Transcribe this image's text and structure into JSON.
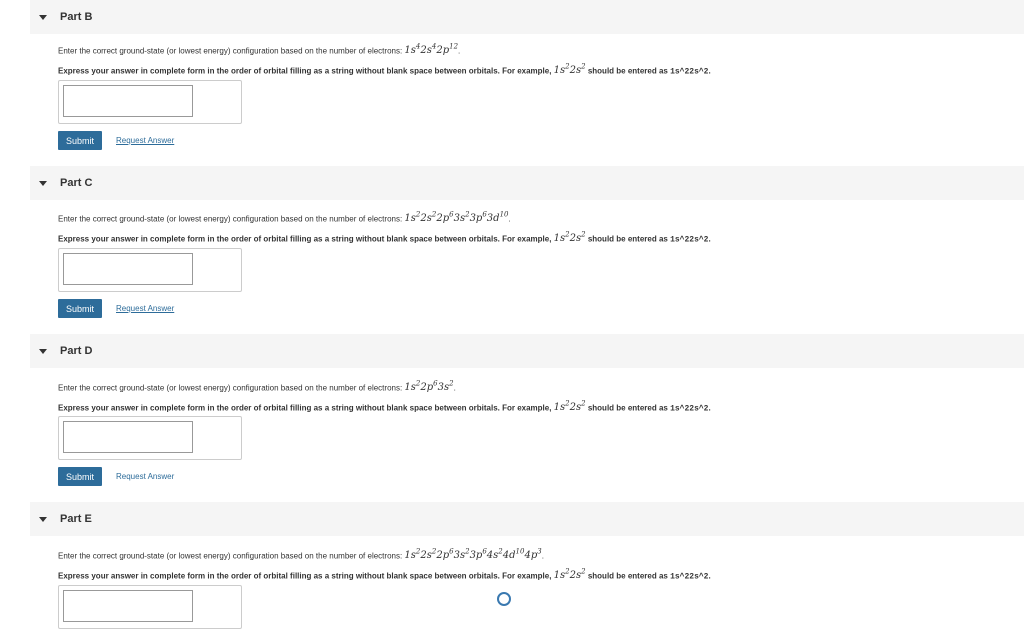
{
  "parts": [
    {
      "title": "Part B",
      "prompt": "Enter the correct ground-state (or lowest energy) configuration based on the number of electrons: ",
      "config": [
        [
          "1s",
          "4"
        ],
        [
          "2s",
          "4"
        ],
        [
          "2p",
          "12"
        ]
      ],
      "submit_label": "Submit",
      "request_label": "Request Answer"
    },
    {
      "title": "Part C",
      "prompt": "Enter the correct ground-state (or lowest energy) configuration based on the number of electrons: ",
      "config": [
        [
          "1s",
          "2"
        ],
        [
          "2s",
          "2"
        ],
        [
          "2p",
          "6"
        ],
        [
          "3s",
          "2"
        ],
        [
          "3p",
          "6"
        ],
        [
          "3d",
          "10"
        ]
      ],
      "submit_label": "Submit",
      "request_label": "Request Answer"
    },
    {
      "title": "Part D",
      "prompt": "Enter the correct ground-state (or lowest energy) configuration based on the number of electrons: ",
      "config": [
        [
          "1s",
          "2"
        ],
        [
          "2p",
          "6"
        ],
        [
          "3s",
          "2"
        ]
      ],
      "submit_label": "Submit",
      "request_label": "Request Answer"
    },
    {
      "title": "Part E",
      "prompt": "Enter the correct ground-state (or lowest energy) configuration based on the number of electrons: ",
      "config": [
        [
          "1s",
          "2"
        ],
        [
          "2s",
          "2"
        ],
        [
          "2p",
          "6"
        ],
        [
          "3s",
          "2"
        ],
        [
          "3p",
          "6"
        ],
        [
          "4s",
          "2"
        ],
        [
          "4d",
          "10"
        ],
        [
          "4p",
          "3"
        ]
      ]
    }
  ],
  "instruction": {
    "text": "Express your answer in complete form in the order of orbital filling as a string without blank space between orbitals. For example, ",
    "example_math": [
      [
        "1s",
        "2"
      ],
      [
        "2s",
        "2"
      ]
    ],
    "mid": " should be entered as ",
    "code": "1s^22s^2",
    "end": "."
  },
  "icons": {
    "collapse": "chevron-down-icon"
  },
  "colors": {
    "accent": "#2d6c9a",
    "header_bg": "#f5f5f5"
  }
}
